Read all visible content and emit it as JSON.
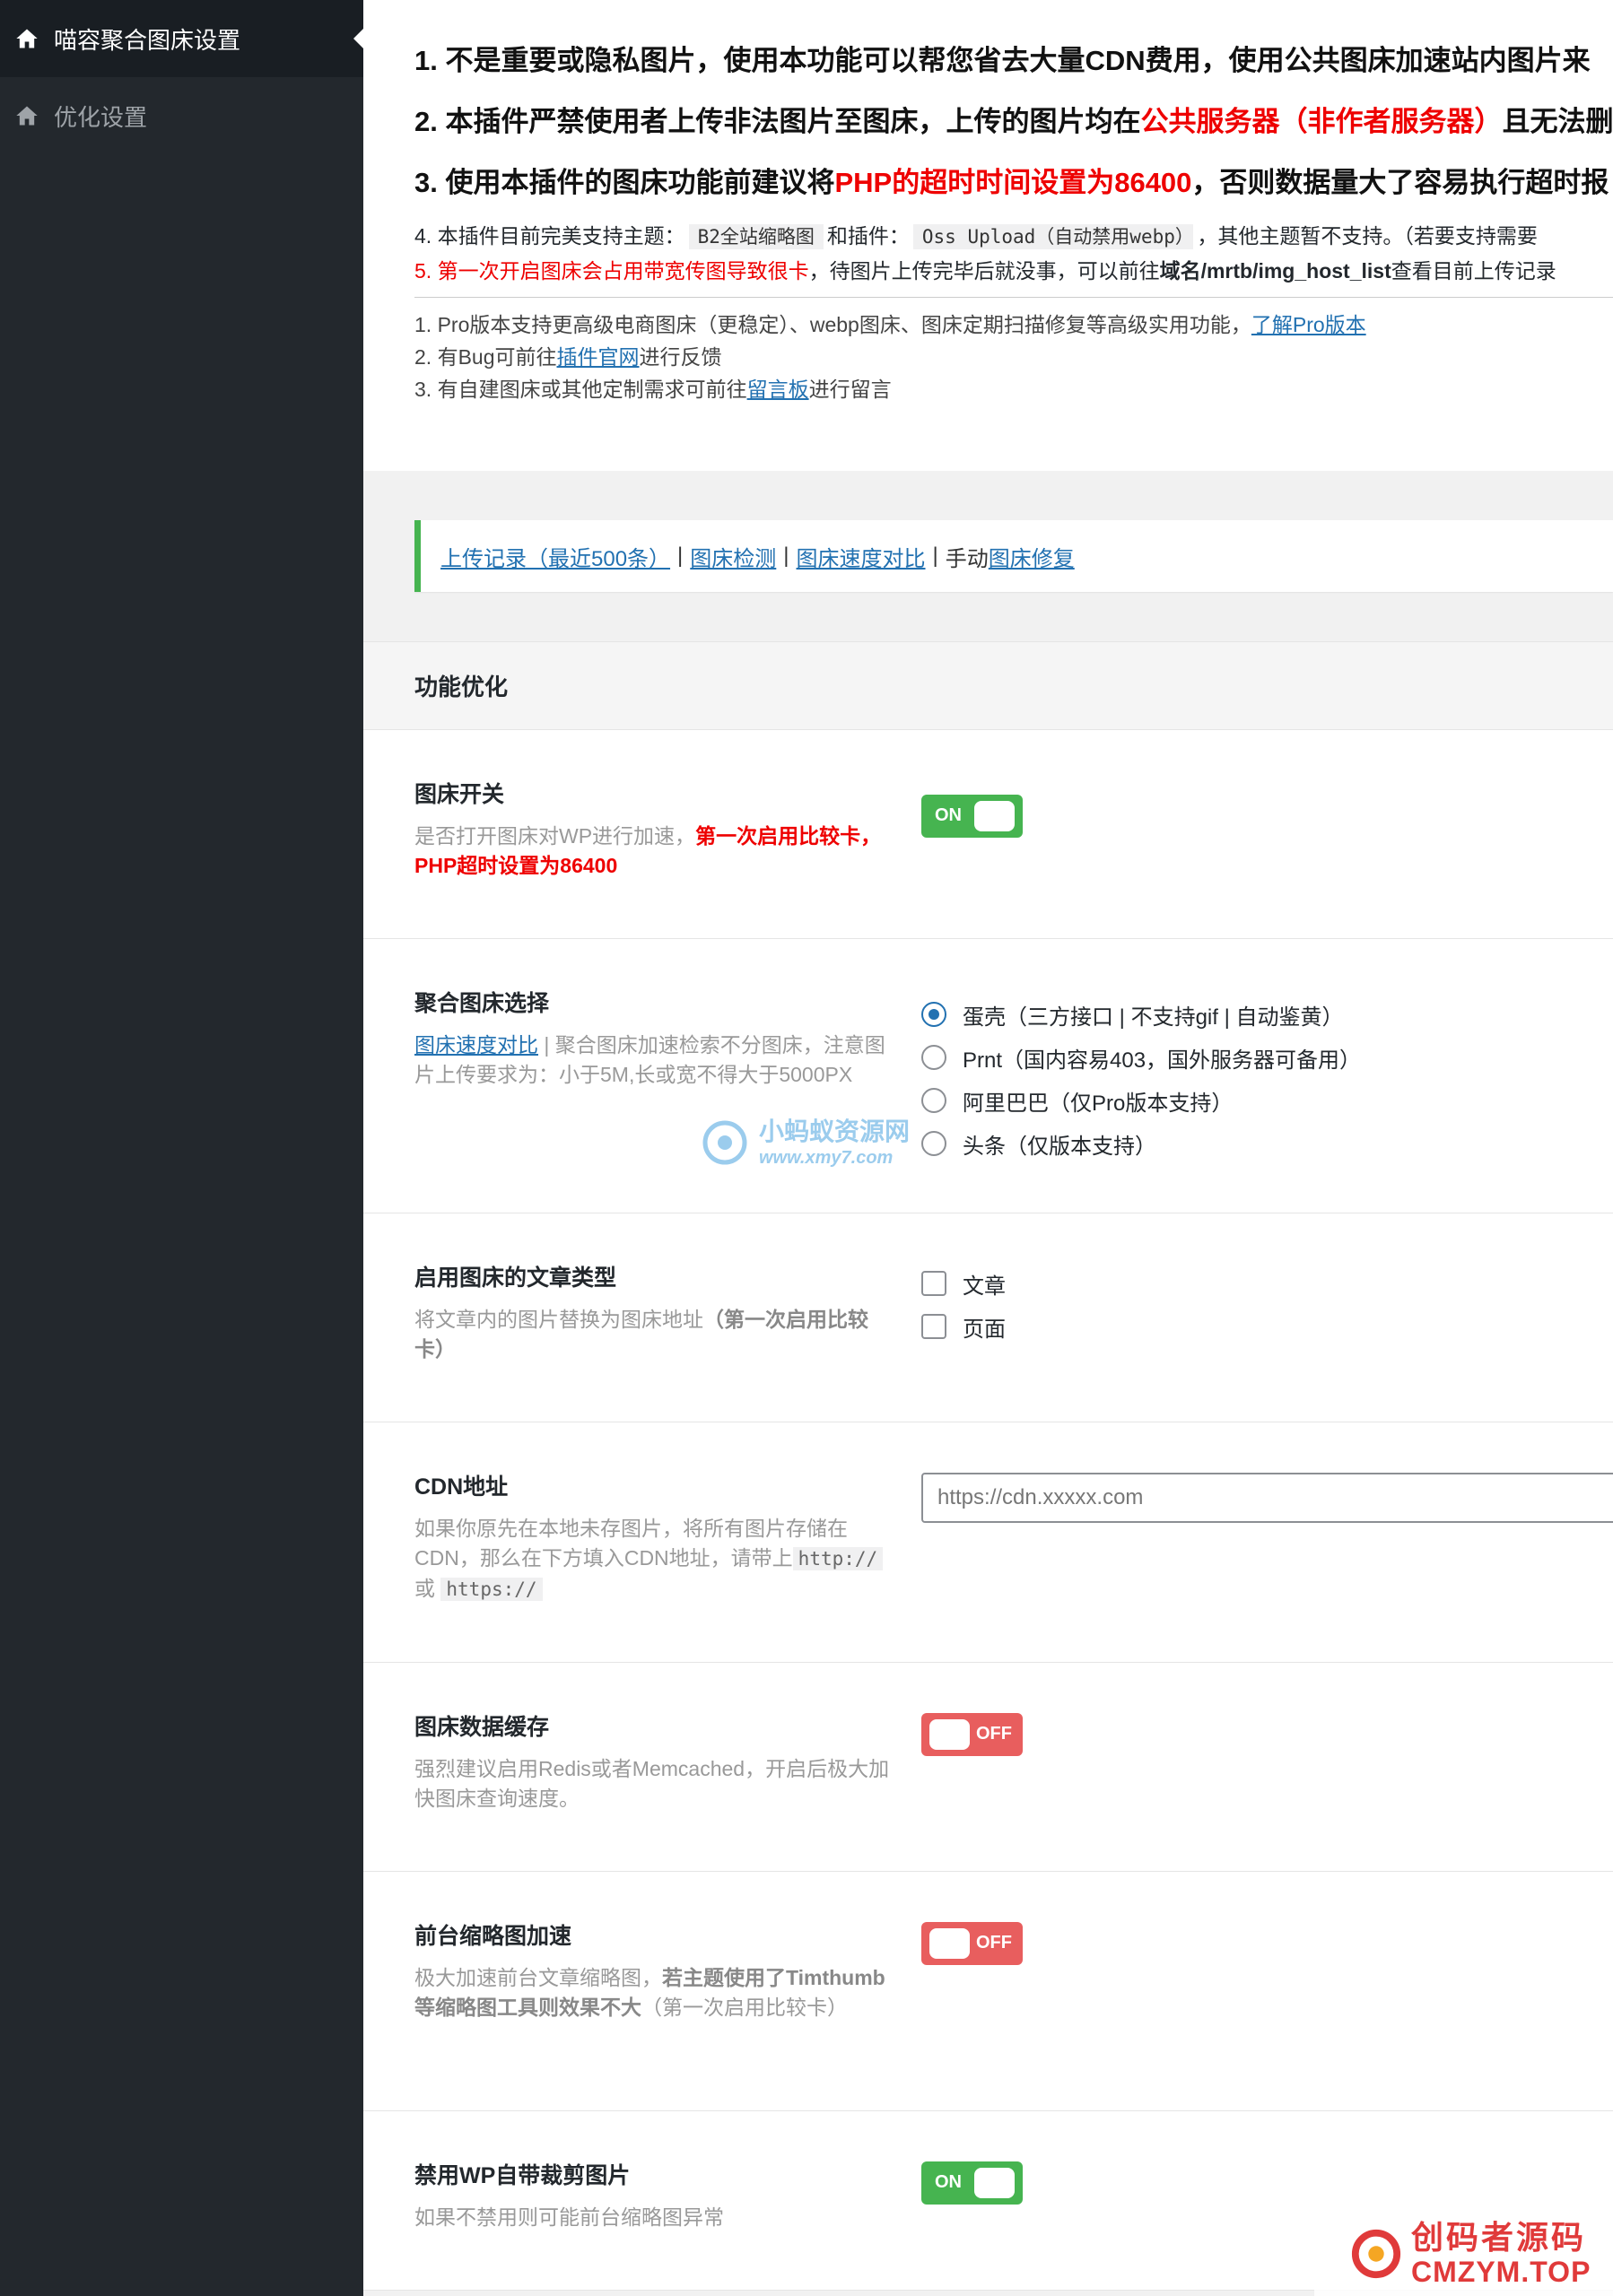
{
  "sidebar": {
    "items": [
      {
        "label": "喵容聚合图床设置",
        "icon": "home-icon",
        "active": true
      },
      {
        "label": "优化设置",
        "icon": "home-icon",
        "active": false
      }
    ]
  },
  "notice": {
    "line1": "1. 不是重要或隐私图片，使用本功能可以帮您省去大量CDN费用，使用公共图床加速站内图片来",
    "line2_a": "2. 本插件严禁使用者上传非法图片至图床，上传的图片均在",
    "line2_red": "公共服务器（非作者服务器）",
    "line2_b": "且无法删",
    "line3_a": "3. 使用本插件的图床功能前建议将",
    "line3_red": "PHP的超时时间设置为86400",
    "line3_b": "，否则数据量大了容易执行超时报",
    "line4_a": "4. 本插件目前完美支持主题：",
    "line4_code1": "B2全站缩略图",
    "line4_b": "和插件：",
    "line4_code2": "Oss Upload（自动禁用webp）",
    "line4_c": "，其他主题暂不支持。（若要支持需要",
    "line5_red": "5. 第一次开启图床会占用带宽传图导致很卡",
    "line5_a": "，待图片上传完毕后就没事，可以前往",
    "line5_bold": "域名/mrtb/img_host_list",
    "line5_b": "查看目前上传记录",
    "pro1_a": "1. Pro版本支持更高级电商图床（更稳定）、webp图床、图床定期扫描修复等高级实用功能，",
    "pro1_link": "了解Pro版本",
    "pro2_a": "2. 有Bug可前往",
    "pro2_link": "插件官网",
    "pro2_b": "进行反馈",
    "pro3_a": "3. 有自建图床或其他定制需求可前往",
    "pro3_link": "留言板",
    "pro3_b": "进行留言"
  },
  "links": {
    "upload_log": "上传记录（最近500条）",
    "check": "图床检测",
    "speed": "图床速度对比",
    "manual": "手动",
    "repair": "图床修复",
    "sep": "|"
  },
  "section": {
    "title": "功能优化"
  },
  "settings": {
    "switch": {
      "label": "图床开关",
      "desc_a": "是否打开图床对WP进行加速，",
      "desc_red": "第一次启用比较卡，PHP超时设置为86400",
      "state": "ON"
    },
    "host_select": {
      "label": "聚合图床选择",
      "desc_link": "图床速度对比",
      "desc": " | 聚合图床加速检索不分图床，注意图片上传要求为：小于5M,长或宽不得大于5000PX",
      "options": [
        {
          "label": "蛋壳（三方接口 | 不支持gif | 自动鉴黄）",
          "checked": true
        },
        {
          "label": "Prnt（国内容易403，国外服务器可备用）",
          "checked": false
        },
        {
          "label": "阿里巴巴（仅Pro版本支持）",
          "checked": false
        },
        {
          "label": "头条（仅版本支持）",
          "checked": false
        }
      ]
    },
    "post_types": {
      "label": "启用图床的文章类型",
      "desc_a": "将文章内的图片替换为图床地址",
      "desc_bold": "（第一次启用比较卡）",
      "options": [
        {
          "label": "文章",
          "checked": false
        },
        {
          "label": "页面",
          "checked": false
        }
      ]
    },
    "cdn": {
      "label": "CDN地址",
      "desc_a": "如果你原先在本地未存图片，将所有图片存储在CDN，那么在下方填入CDN地址，请带上",
      "code1": "http://",
      "or": " 或 ",
      "code2": "https://",
      "placeholder": "https://cdn.xxxxx.com",
      "value": ""
    },
    "cache": {
      "label": "图床数据缓存",
      "desc": "强烈建议启用Redis或者Memcached，开启后极大加快图床查询速度。",
      "state": "OFF"
    },
    "thumb": {
      "label": "前台缩略图加速",
      "desc_a": "极大加速前台文章缩略图，",
      "desc_bold": "若主题使用了Timthumb等缩略图工具则效果不大",
      "desc_b": "（第一次启用比较卡）",
      "state": "OFF"
    },
    "crop": {
      "label": "禁用WP自带裁剪图片",
      "desc": "如果不禁用则可能前台缩略图异常",
      "state": "ON"
    }
  },
  "watermarks": {
    "center_cn": "小蚂蚁资源网",
    "center_url": "www.xmy7.com",
    "corner_cn": "创码者源码",
    "corner_en": "CMZYM.TOP"
  }
}
